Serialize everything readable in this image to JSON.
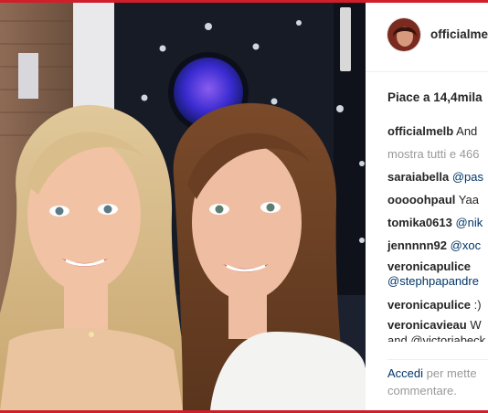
{
  "post": {
    "username": "officialme",
    "likes": "Piace a 14,4mila",
    "caption": {
      "user": "officialmelb",
      "text": "And"
    },
    "show_all": "mostra tutti e 466",
    "comments": [
      {
        "user": "saraiabella",
        "text": "",
        "mention": "@pas"
      },
      {
        "user": "ooooohpaul",
        "text": "Yaa",
        "mention": ""
      },
      {
        "user": "tomika0613",
        "text": "",
        "mention": "@nik"
      },
      {
        "user": "jennnnn92",
        "text": "",
        "mention": "@xoc"
      },
      {
        "user": "veronicapulice",
        "text": "",
        "mention": ""
      },
      {
        "user": "",
        "text": "",
        "mention": "@stephpapandre"
      },
      {
        "user": "veronicapulice",
        "text": ":)",
        "mention": ""
      },
      {
        "user": "veronicavieau",
        "text": "W",
        "mention": ""
      }
    ],
    "cut_line": {
      "text": "and",
      "mention": "@victoriabeck"
    },
    "login": {
      "link": "Accedi",
      "text": "per mette",
      "text2": "commentare."
    }
  },
  "colors": {
    "frame": "#d01f2a",
    "link": "#003569",
    "muted": "#999999",
    "text": "#262626"
  }
}
